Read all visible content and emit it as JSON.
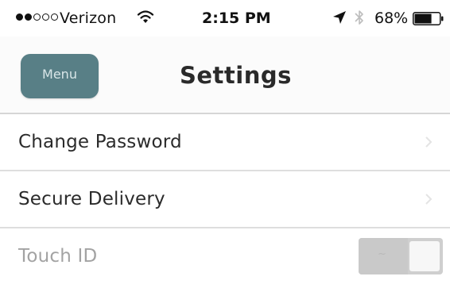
{
  "status_bar": {
    "carrier": "Verizon",
    "signal_strength": 2,
    "signal_max": 5,
    "time": "2:15 PM",
    "battery_percent": "68%",
    "battery_level": 0.68,
    "icons": [
      "wifi-icon",
      "location-arrow-icon",
      "bluetooth-icon",
      "battery-icon"
    ]
  },
  "nav": {
    "menu_label": "Menu",
    "title": "Settings"
  },
  "settings": {
    "items": [
      {
        "label": "Change Password",
        "type": "link",
        "icon": "chevron-right-icon"
      },
      {
        "label": "Secure Delivery",
        "type": "link",
        "icon": "chevron-right-icon"
      },
      {
        "label": "Touch ID",
        "type": "toggle",
        "enabled": false
      }
    ]
  },
  "colors": {
    "menu_button": "#587f86",
    "disabled_text": "#a3a3a3",
    "toggle_off": "#c9c9c9"
  }
}
